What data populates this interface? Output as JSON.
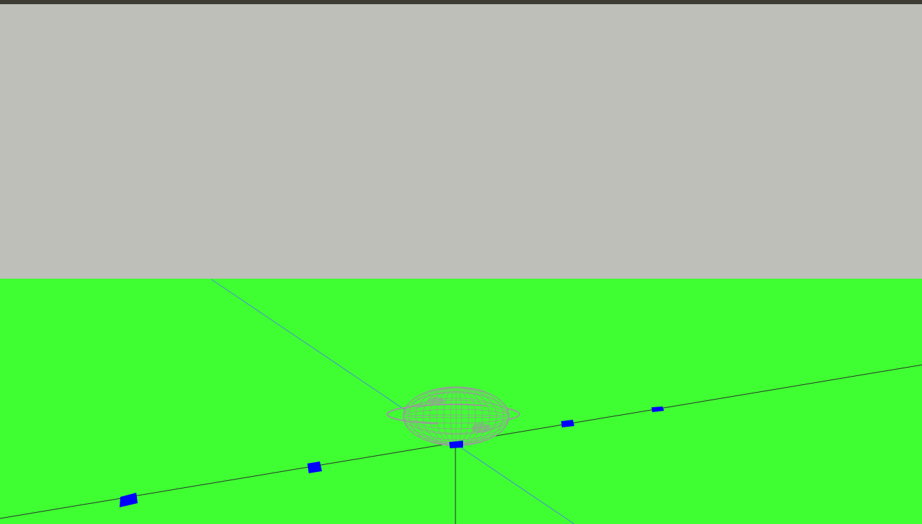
{
  "window": {
    "title_bar_color": "#3c3c35"
  },
  "scene": {
    "sky_color": "#bfbfb9",
    "ground_color": "#3fff33",
    "object_wireframe_color": "#9a9a9a",
    "marker_color": "#0000ff",
    "axis_line_color": "#2a2a2a",
    "diagonal_axis_color": "#4a8ad8",
    "objects": [
      {
        "name": "wireframe-sphere-with-ring"
      },
      {
        "name": "marker-block"
      },
      {
        "name": "marker-block"
      },
      {
        "name": "marker-block"
      },
      {
        "name": "marker-block"
      },
      {
        "name": "marker-block"
      }
    ]
  }
}
